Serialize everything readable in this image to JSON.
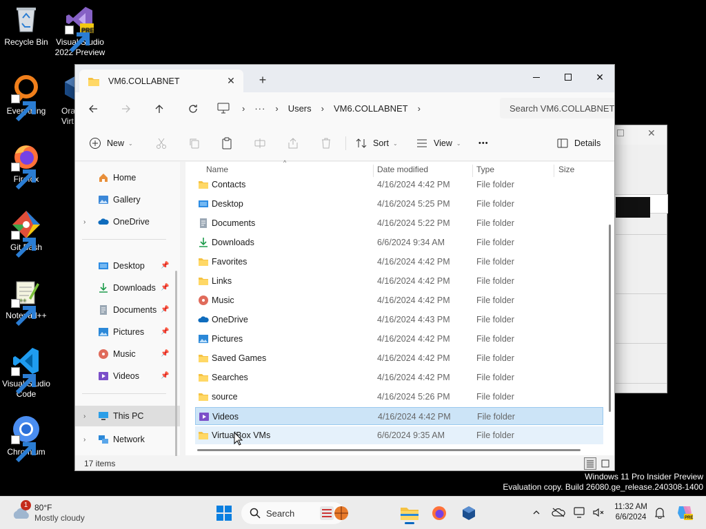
{
  "desktop": {
    "icons": [
      {
        "label": "Recycle Bin",
        "icon": "recycle-bin-icon"
      },
      {
        "label": "Visual Studio 2022 Preview",
        "icon": "visual-studio-icon",
        "badge": "PRE"
      },
      {
        "label": "Everything",
        "icon": "everything-icon"
      },
      {
        "label": "Ora Virt",
        "icon": "virtualbox-icon"
      },
      {
        "label": "Firefox",
        "icon": "firefox-icon"
      },
      {
        "label": "Git Bash",
        "icon": "git-bash-icon"
      },
      {
        "label": "Notepad++",
        "icon": "notepad-plus-plus-icon"
      },
      {
        "label": "Visual Studio Code",
        "icon": "vscode-icon"
      },
      {
        "label": "Chromium",
        "icon": "chromium-icon"
      }
    ],
    "watermark": {
      "line1": "Windows 11 Pro Insider Preview",
      "line2": "Evaluation copy. Build 26080.ge_release.240308-1400"
    }
  },
  "explorer": {
    "tab_title": "VM6.COLLABNET",
    "tab_close": "✕",
    "new_tab": "+",
    "window_controls": {
      "minimize": "—",
      "maximize": "☐",
      "close": "✕"
    },
    "breadcrumb": [
      "Users",
      "VM6.COLLABNET"
    ],
    "search_placeholder": "Search VM6.COLLABNET",
    "toolbar": {
      "new_label": "New",
      "sort_label": "Sort",
      "view_label": "View",
      "more_label": "•••",
      "details_label": "Details"
    },
    "nav": {
      "top": [
        {
          "label": "Home",
          "icon": "home-icon"
        },
        {
          "label": "Gallery",
          "icon": "gallery-icon"
        },
        {
          "label": "OneDrive",
          "icon": "onedrive-icon",
          "expandable": true
        }
      ],
      "quick_access": [
        {
          "label": "Desktop",
          "icon": "desktop-folder-icon"
        },
        {
          "label": "Downloads",
          "icon": "downloads-icon"
        },
        {
          "label": "Documents",
          "icon": "documents-icon"
        },
        {
          "label": "Pictures",
          "icon": "pictures-icon"
        },
        {
          "label": "Music",
          "icon": "music-icon"
        },
        {
          "label": "Videos",
          "icon": "videos-icon"
        }
      ],
      "bottom": [
        {
          "label": "This PC",
          "icon": "this-pc-icon",
          "selected": true
        },
        {
          "label": "Network",
          "icon": "network-icon"
        }
      ]
    },
    "columns": {
      "name": "Name",
      "date": "Date modified",
      "type": "Type",
      "size": "Size"
    },
    "files": [
      {
        "name": "Contacts",
        "date": "4/16/2024 4:42 PM",
        "type": "File folder",
        "icon": "contacts-folder-icon"
      },
      {
        "name": "Desktop",
        "date": "4/16/2024 5:25 PM",
        "type": "File folder",
        "icon": "desktop-folder-icon"
      },
      {
        "name": "Documents",
        "date": "4/16/2024 5:22 PM",
        "type": "File folder",
        "icon": "documents-icon"
      },
      {
        "name": "Downloads",
        "date": "6/6/2024 9:34 AM",
        "type": "File folder",
        "icon": "downloads-icon"
      },
      {
        "name": "Favorites",
        "date": "4/16/2024 4:42 PM",
        "type": "File folder",
        "icon": "folder-icon"
      },
      {
        "name": "Links",
        "date": "4/16/2024 4:42 PM",
        "type": "File folder",
        "icon": "folder-icon"
      },
      {
        "name": "Music",
        "date": "4/16/2024 4:42 PM",
        "type": "File folder",
        "icon": "music-icon"
      },
      {
        "name": "OneDrive",
        "date": "4/16/2024 4:43 PM",
        "type": "File folder",
        "icon": "onedrive-icon"
      },
      {
        "name": "Pictures",
        "date": "4/16/2024 4:42 PM",
        "type": "File folder",
        "icon": "pictures-icon"
      },
      {
        "name": "Saved Games",
        "date": "4/16/2024 4:42 PM",
        "type": "File folder",
        "icon": "folder-icon"
      },
      {
        "name": "Searches",
        "date": "4/16/2024 4:42 PM",
        "type": "File folder",
        "icon": "folder-icon"
      },
      {
        "name": "source",
        "date": "4/16/2024 5:26 PM",
        "type": "File folder",
        "icon": "folder-icon"
      },
      {
        "name": "Videos",
        "date": "4/16/2024 4:42 PM",
        "type": "File folder",
        "icon": "videos-icon",
        "state": "selected"
      },
      {
        "name": "VirtualBox VMs",
        "date": "6/6/2024 9:35 AM",
        "type": "File folder",
        "icon": "folder-icon",
        "state": "hover"
      }
    ],
    "status_count": "17 items"
  },
  "taskbar": {
    "weather": {
      "temp": "80°F",
      "condition": "Mostly cloudy",
      "badge": "1"
    },
    "search_label": "Search",
    "time": "11:32 AM",
    "date": "6/6/2024",
    "colors": {
      "accent": "#0067c0",
      "badge": "#c42b1c"
    }
  }
}
